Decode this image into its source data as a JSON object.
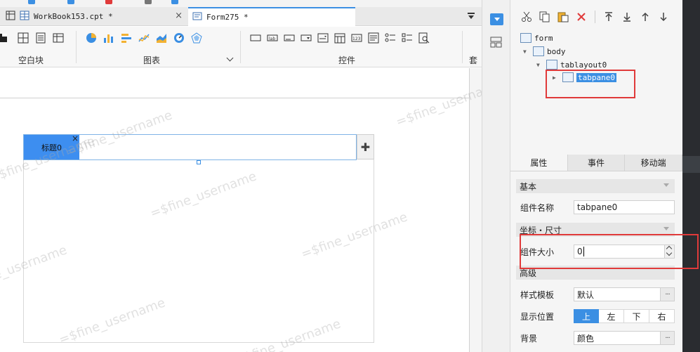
{
  "tabs": [
    {
      "label": "WorkBook153.cpt *",
      "active": false
    },
    {
      "label": "Form275 *",
      "active": true
    }
  ],
  "ribbon": {
    "groups": [
      {
        "label": "空白块"
      },
      {
        "label": "图表",
        "has_dropdown": true
      },
      {
        "label": "控件"
      },
      {
        "label": "套用"
      }
    ]
  },
  "canvas": {
    "tab_title": "标题0",
    "tab_close": "×",
    "add_tab_symbol": "✚",
    "watermark": "=$fine_username"
  },
  "tree": {
    "nodes": [
      {
        "label": "form",
        "level": 0,
        "expanded": true
      },
      {
        "label": "body",
        "level": 1,
        "expanded": true
      },
      {
        "label": "tablayout0",
        "level": 2,
        "expanded": true
      },
      {
        "label": "tabpane0",
        "level": 3,
        "expanded": false,
        "selected": true
      }
    ]
  },
  "props": {
    "tabs": [
      {
        "label": "属性",
        "active": true
      },
      {
        "label": "事件",
        "active": false
      },
      {
        "label": "移动端",
        "active": false
      }
    ],
    "sections": {
      "basic": "基本",
      "coords": "坐标・尺寸",
      "advanced": "高级"
    },
    "widget_name_label": "组件名称",
    "widget_name_value": "tabpane0",
    "widget_size_label": "组件大小",
    "widget_size_value": "0",
    "style_template_label": "样式模板",
    "style_template_value": "默认",
    "display_position_label": "显示位置",
    "display_position_options": [
      "上",
      "左",
      "下",
      "右"
    ],
    "display_position_selected": "上",
    "background_label": "背景",
    "background_value": "颜色",
    "dots": "···"
  },
  "colors": {
    "accent": "#3b8fe3",
    "highlight_box": "#e03a3a",
    "tab_fill": "#3d8ef0"
  }
}
